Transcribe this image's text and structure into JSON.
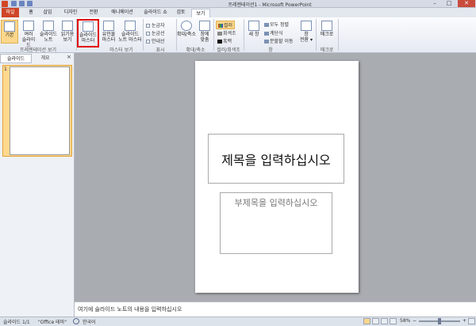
{
  "window": {
    "title": "프레젠테이션1 - Microsoft PowerPoint",
    "min": "–",
    "max": "□",
    "close": "✕"
  },
  "tabs": {
    "file": "파일",
    "home": "홈",
    "insert": "삽입",
    "design": "디자인",
    "transitions": "전환",
    "animations": "애니메이션",
    "slideshow": "슬라이드 쇼",
    "review": "검토",
    "view": "보기"
  },
  "ribbon": {
    "normal": "기본",
    "slide_sorter": [
      "여러",
      "슬라이드"
    ],
    "notes_page": [
      "슬라이드",
      "노트"
    ],
    "reading_view": [
      "읽기용",
      "보기"
    ],
    "slide_master": [
      "슬라이드",
      "마스터"
    ],
    "handout_master": [
      "유인물",
      "마스터"
    ],
    "notes_master": [
      "슬라이드",
      "노트 마스터"
    ],
    "ruler": "눈금자",
    "gridlines": "눈금선",
    "guides": "안내선",
    "zoom": "확대/축소",
    "fit": [
      "창에",
      "맞춤"
    ],
    "color": "컬러",
    "grayscale": "회색조",
    "bw": "흑백",
    "new_window": "새 창",
    "arrange_all": "모두 정렬",
    "cascade": "계단식",
    "move_split": "분할할 이동",
    "switch": [
      "창",
      "전환 ▾"
    ],
    "macros": "매크로",
    "groups": {
      "presentation_views": "프레젠테이션 보기",
      "master_views": "마스터 보기",
      "show": "표시",
      "zoom": "확대/축소",
      "color": "컬러/회색조",
      "window": "창",
      "macros": "매크로"
    }
  },
  "panel": {
    "tab_slides": "슬라이드",
    "tab_outline": "개요",
    "close": "×",
    "thumb_num": "1"
  },
  "slide": {
    "title_placeholder": "제목을 입력하십시오",
    "subtitle_placeholder": "부제목을 입력하십시오"
  },
  "notes": {
    "placeholder": "여기에 슬라이드 노트의 내용을 입력하십시오"
  },
  "status": {
    "slide": "슬라이드 1/1",
    "theme": "\"Office 테마\"",
    "lang": "한국어",
    "zoom": "58%",
    "minus": "−",
    "plus": "+"
  }
}
